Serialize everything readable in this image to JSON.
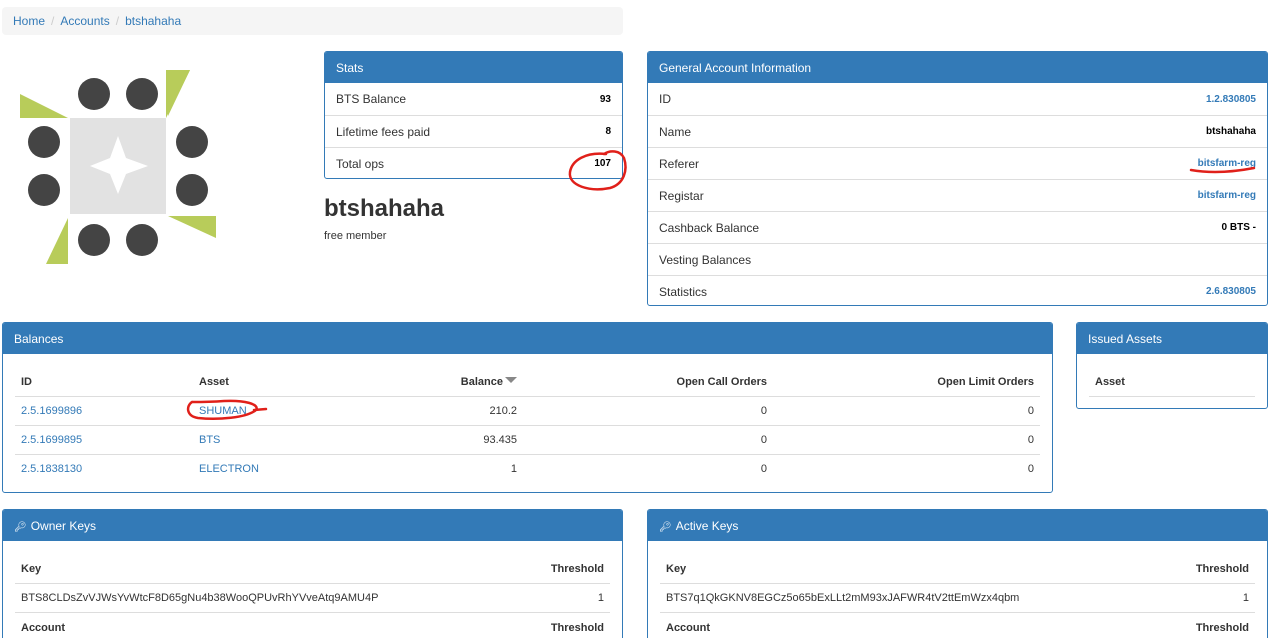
{
  "breadcrumb": {
    "home": "Home",
    "accounts": "Accounts",
    "current": "btshahaha"
  },
  "account": {
    "name": "btshahaha",
    "membership": "free member"
  },
  "stats": {
    "title": "Stats",
    "rows": [
      {
        "label": "BTS Balance",
        "value": "93"
      },
      {
        "label": "Lifetime fees paid",
        "value": "8"
      },
      {
        "label": "Total ops",
        "value": "107"
      }
    ]
  },
  "general": {
    "title": "General Account Information",
    "rows": [
      {
        "label": "ID",
        "value": "1.2.830805"
      },
      {
        "label": "Name",
        "value": "btshahaha"
      },
      {
        "label": "Referer",
        "value": "bitsfarm-reg"
      },
      {
        "label": "Registar",
        "value": "bitsfarm-reg"
      },
      {
        "label": "Cashback Balance",
        "value": "0 BTS -"
      },
      {
        "label": "Vesting Balances",
        "value": ""
      },
      {
        "label": "Statistics",
        "value": "2.6.830805"
      }
    ]
  },
  "balances": {
    "title": "Balances",
    "headers": {
      "id": "ID",
      "asset": "Asset",
      "balance": "Balance",
      "call": "Open Call Orders",
      "limit": "Open Limit Orders"
    },
    "rows": [
      {
        "id": "2.5.1699896",
        "asset": "SHUMAN",
        "balance": "210.2",
        "call": "0",
        "limit": "0"
      },
      {
        "id": "2.5.1699895",
        "asset": "BTS",
        "balance": "93.435",
        "call": "0",
        "limit": "0"
      },
      {
        "id": "2.5.1838130",
        "asset": "ELECTRON",
        "balance": "1",
        "call": "0",
        "limit": "0"
      }
    ]
  },
  "issued": {
    "title": "Issued Assets",
    "header": "Asset"
  },
  "owner_keys": {
    "title": "Owner Keys",
    "key_header": "Key",
    "threshold_header": "Threshold",
    "key": "BTS8CLDsZvVJWsYvWtcF8D65gNu4b38WooQPUvRhYVveAtq9AMU4P",
    "key_threshold": "1",
    "account_header": "Account",
    "account_threshold_header": "Threshold"
  },
  "active_keys": {
    "title": "Active Keys",
    "key_header": "Key",
    "threshold_header": "Threshold",
    "key": "BTS7q1QkGKNV8EGCz5o65bExLLt2mM93xJAFWR4tV2ttEmWzx4qbm",
    "key_threshold": "1",
    "account_header": "Account",
    "account_threshold_header": "Threshold"
  },
  "icons": {
    "key": "key-icon",
    "identicon": "identicon-avatar"
  },
  "colors": {
    "panel": "#337ab7",
    "identicon_green": "#b8cc5a",
    "identicon_dark": "#444444",
    "annotation": "#e0201a"
  }
}
